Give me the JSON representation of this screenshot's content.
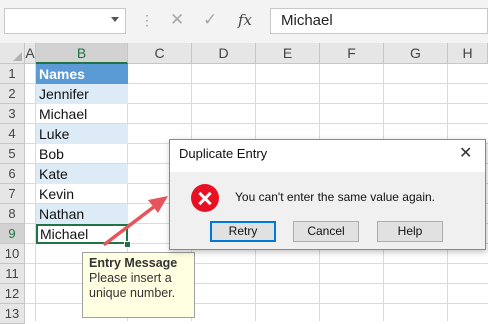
{
  "formula_bar": {
    "name_box": "",
    "cancel_icon": "✕",
    "enter_icon": "✓",
    "fx_label": "fx",
    "content": "Michael"
  },
  "columns": [
    "A",
    "B",
    "C",
    "D",
    "E",
    "F",
    "G",
    "H"
  ],
  "rows": [
    "1",
    "2",
    "3",
    "4",
    "5",
    "6",
    "7",
    "8",
    "9",
    "10",
    "11",
    "12",
    "13"
  ],
  "cells": [
    "Names",
    "Jennifer",
    "Michael",
    "Luke",
    "Bob",
    "Kate",
    "Kevin",
    "Nathan",
    "Michael"
  ],
  "selected_column": "B",
  "selected_row": "9",
  "colors": {
    "table_header": "#5b9bd5",
    "table_band": "#ddebf7",
    "excel_green": "#217346",
    "error_red": "#e81123",
    "arrow_red": "#e8545b"
  },
  "input_message": {
    "title": "Entry Message",
    "text": "Please insert a unique number."
  },
  "dialog": {
    "title": "Duplicate Entry",
    "close": "✕",
    "icon": "error-icon",
    "message": "You can't enter the same value again.",
    "buttons": {
      "retry": "Retry",
      "cancel": "Cancel",
      "help": "Help"
    }
  }
}
